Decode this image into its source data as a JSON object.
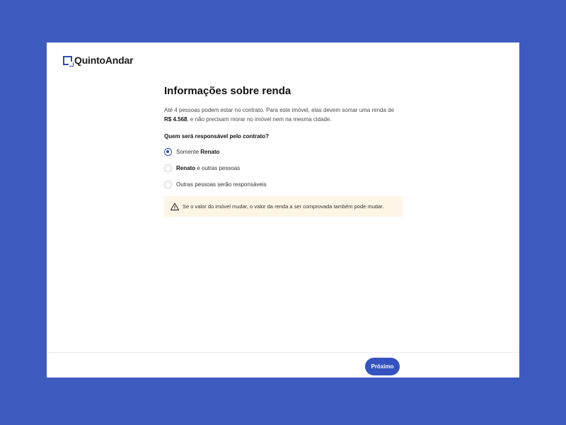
{
  "brand": {
    "name": "QuintoAndar",
    "color": "#2f4fb3"
  },
  "page": {
    "title": "Informações sobre renda",
    "description_part1": "Até 4 pessoas podem estar no contrato. Para este imóvel, elas devem somar uma renda de ",
    "income_value": "R$ 4.568",
    "description_part2": ", e não precisam morar no imóvel nem na mesma cidade."
  },
  "question": "Quem será responsável pelo contrato?",
  "options": [
    {
      "prefix": "Somente ",
      "bold": "Renato",
      "suffix": "",
      "selected": true
    },
    {
      "prefix": "",
      "bold": "Renato",
      "suffix": " e outras pessoas",
      "selected": false
    },
    {
      "prefix": "Outras pessoas serão responsáveis",
      "bold": "",
      "suffix": "",
      "selected": false
    }
  ],
  "notice": {
    "icon": "warning-icon",
    "text": "Se o valor do imóvel mudar, o valor da renda a ser comprovada também pode mudar."
  },
  "footer": {
    "next_label": "Próximo"
  },
  "colors": {
    "background": "#3d5bbf",
    "button": "#3553c0",
    "notice_bg": "#fdf5e6"
  }
}
